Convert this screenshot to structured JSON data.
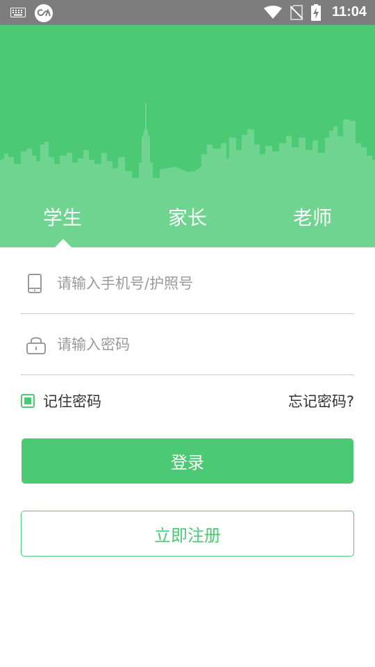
{
  "status_bar": {
    "time": "11:04",
    "icons": [
      "keyboard-icon",
      "app-notification-icon",
      "wifi-icon",
      "no-sim-icon",
      "battery-charging-icon"
    ]
  },
  "tabs": [
    {
      "label": "学生",
      "selected": true
    },
    {
      "label": "家长",
      "selected": false
    },
    {
      "label": "老师",
      "selected": false
    }
  ],
  "form": {
    "phone_placeholder": "请输入手机号/护照号",
    "phone_value": "",
    "password_placeholder": "请输入密码",
    "password_value": "",
    "remember_label": "记住密码",
    "remember_checked": true,
    "forgot_label": "忘记密码?"
  },
  "buttons": {
    "login": "登录",
    "register": "立即注册"
  },
  "colors": {
    "brand_green": "#4bc974",
    "skyline_green": "#6fd48f",
    "status_bar": "#7d7d7d"
  }
}
